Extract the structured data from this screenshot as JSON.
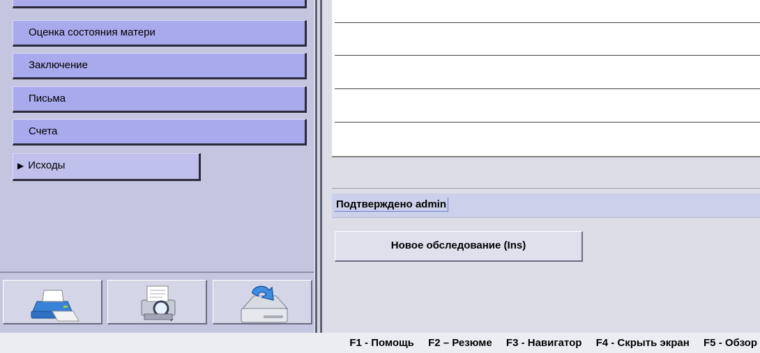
{
  "navigation": {
    "items": [
      {
        "label": ""
      },
      {
        "label": "Оценка состояния матери"
      },
      {
        "label": "Заключение"
      },
      {
        "label": "Письма"
      },
      {
        "label": "Счета"
      }
    ],
    "active_item": {
      "label": "Исходы",
      "arrow": "▶"
    }
  },
  "toolbar": {
    "buttons": [
      {
        "icon": "printer-icon"
      },
      {
        "icon": "print-preview-icon"
      },
      {
        "icon": "save-to-drive-icon"
      }
    ]
  },
  "main": {
    "confirmation": "Подтверждено admin",
    "new_exam_label": "Новое обследование (Ins)"
  },
  "status_bar": {
    "hotkeys": [
      "F1 - Помощь",
      "F2 – Резюме",
      "F3 - Навигатор",
      "F4 - Скрыть экран",
      "F5 - Обзор"
    ]
  },
  "colors": {
    "nav_button": "#a9a9ed",
    "panel_bg": "#c4c5df",
    "confirm_band": "#cdd0ea"
  }
}
